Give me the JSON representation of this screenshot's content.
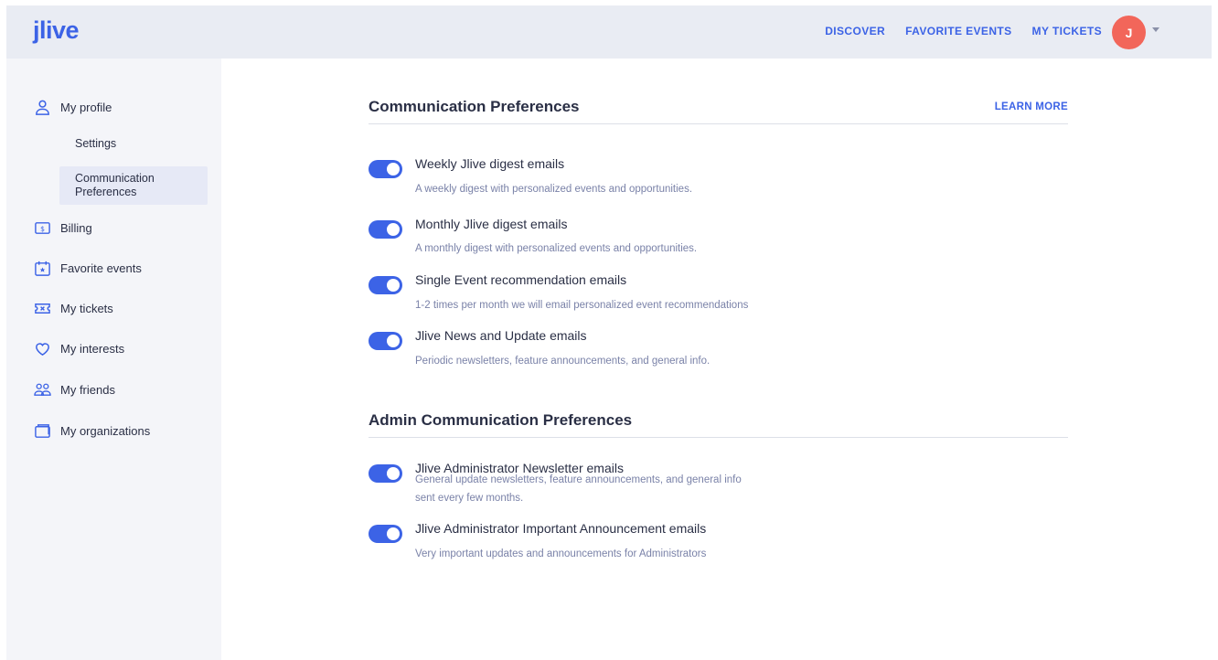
{
  "header": {
    "logo": "jlive",
    "nav": [
      "DISCOVER",
      "FAVORITE EVENTS",
      "MY TICKETS"
    ],
    "avatar_initial": "J"
  },
  "sidebar": {
    "profile": "My profile",
    "settings": "Settings",
    "comm_prefs_line1": "Communication",
    "comm_prefs_line2": "Preferences",
    "billing": "Billing",
    "favorite_events": "Favorite events",
    "my_tickets": "My tickets",
    "my_interests": "My interests",
    "my_friends": "My friends",
    "my_organizations": "My organizations"
  },
  "main": {
    "section1_title": "Communication Preferences",
    "learn_more": "LEARN MORE",
    "section2_title": "Admin Communication Preferences",
    "prefs": [
      {
        "title": "Weekly Jlive digest emails",
        "desc": "A weekly digest with personalized events and opportunities.",
        "enabled": true
      },
      {
        "title": "Monthly Jlive digest emails",
        "desc": "A monthly digest with personalized events and opportunities.",
        "enabled": true
      },
      {
        "title": "Single Event recommendation emails",
        "desc": "1-2 times per month we will email personalized event recommendations",
        "enabled": true
      },
      {
        "title": "Jlive News and Update emails",
        "desc": "Periodic newsletters, feature announcements, and general info.",
        "enabled": true
      }
    ],
    "admin_prefs": [
      {
        "title": "Jlive Administrator Newsletter emails",
        "desc_line1": "General update newsletters, feature announcements, and general info",
        "desc_line2": "sent every few months.",
        "enabled": true
      },
      {
        "title": "Jlive Administrator Important Announcement emails",
        "desc": "Very important updates and announcements for Administrators",
        "enabled": true
      }
    ]
  },
  "colors": {
    "accent": "#3c63e6",
    "avatar": "#f2665a",
    "header_bg": "#e9ecf3",
    "sidebar_bg": "#f4f5f9"
  }
}
